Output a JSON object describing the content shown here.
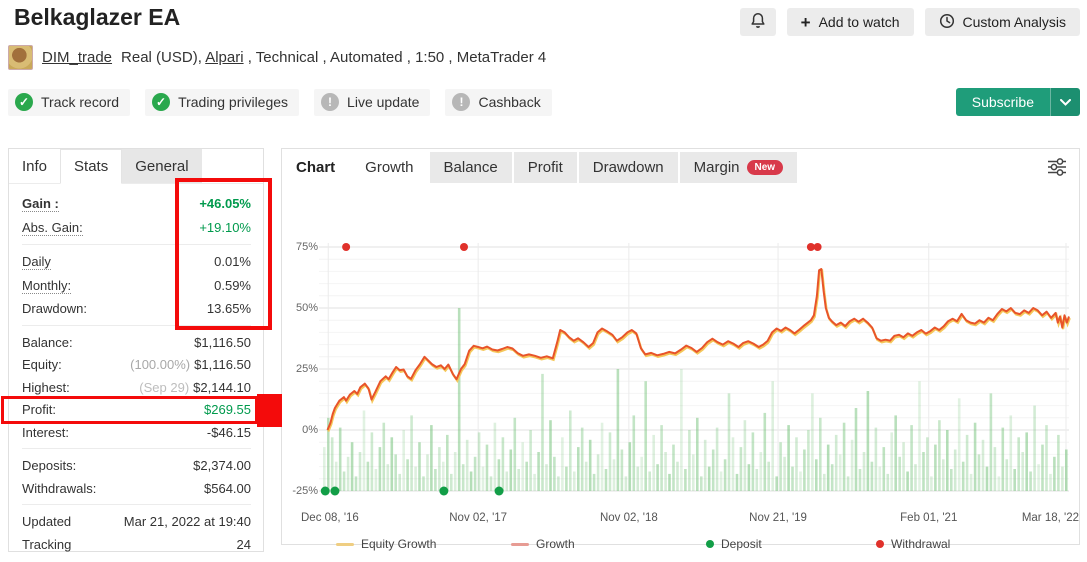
{
  "header": {
    "title": "Belkaglazer EA",
    "add_to_watch": "Add to watch",
    "custom_analysis": "Custom Analysis",
    "subscribe": "Subscribe"
  },
  "account": {
    "username": "DIM_trade",
    "info_pre": "Real (USD), ",
    "broker": "Alpari",
    "info_post": " , Technical , Automated , 1:50 , MetaTrader 4"
  },
  "badges": [
    {
      "label": "Track record",
      "status": "ok"
    },
    {
      "label": "Trading privileges",
      "status": "ok"
    },
    {
      "label": "Live update",
      "status": "info"
    },
    {
      "label": "Cashback",
      "status": "info"
    }
  ],
  "left_panel": {
    "tabs": [
      "Info",
      "Stats",
      "General"
    ],
    "active_tab": "Stats",
    "rows": [
      {
        "label": "Gain :",
        "value": "+46.05%"
      },
      {
        "label": "Abs. Gain:",
        "value": "+19.10%"
      },
      {
        "label": "Daily",
        "value": "0.01%"
      },
      {
        "label": "Monthly:",
        "value": "0.59%"
      },
      {
        "label": "Drawdown:",
        "value": "13.65%"
      },
      {
        "label": "Balance:",
        "value": "$1,116.50"
      },
      {
        "label": "Equity:",
        "prefix": "(100.00%)",
        "value": "$1,116.50"
      },
      {
        "label": "Highest:",
        "prefix": "(Sep 29)",
        "value": "$2,144.10"
      },
      {
        "label": "Profit:",
        "value": "$269.55"
      },
      {
        "label": "Interest:",
        "value": "-$46.15"
      },
      {
        "label": "Deposits:",
        "value": "$2,374.00"
      },
      {
        "label": "Withdrawals:",
        "value": "$564.00"
      },
      {
        "label": "Updated",
        "value": "Mar 21, 2022 at 19:40"
      },
      {
        "label": "Tracking",
        "value": "24"
      }
    ]
  },
  "chart_panel": {
    "label": "Chart",
    "tabs": [
      "Growth",
      "Balance",
      "Profit",
      "Drawdown",
      "Margin"
    ],
    "active_tab": "Growth",
    "margin_badge": "New"
  },
  "colors": {
    "growth_line": "#e8542a",
    "equity_line": "#f5c75a",
    "bar_green": "#6abe70",
    "deposit_dot": "#129e47",
    "withdrawal_dot": "#e0312b",
    "gain_green": "#009a4d",
    "subscribe_teal": "#1f9d7a",
    "annotation_red": "#f40b0b"
  },
  "chart_data": {
    "type": "line",
    "title": "Growth",
    "ylim": [
      -25,
      78
    ],
    "y_ticks": [
      "75%",
      "50%",
      "25%",
      "0%",
      "-25%"
    ],
    "y_tick_values": [
      75,
      50,
      25,
      0,
      -25
    ],
    "x_ticks": [
      "Dec 08, '16",
      "Nov 02, '17",
      "Nov 02, '18",
      "Nov 21, '19",
      "Feb 01, '21",
      "Mar 18, '22"
    ],
    "x_tick_fractions": [
      0.007,
      0.208,
      0.41,
      0.61,
      0.812,
      0.996
    ],
    "legend": [
      {
        "label": "Equity Growth",
        "type": "line",
        "color": "#efce82"
      },
      {
        "label": "Growth",
        "type": "line",
        "color": "#e79c94"
      },
      {
        "label": "Deposit",
        "type": "dot",
        "color": "#129e47"
      },
      {
        "label": "Withdrawal",
        "type": "dot",
        "color": "#e0312b"
      }
    ],
    "series": [
      {
        "name": "Growth",
        "color": "#e8542a",
        "points": [
          [
            0.006,
            0
          ],
          [
            0.01,
            3
          ],
          [
            0.013,
            6.5
          ],
          [
            0.016,
            9
          ],
          [
            0.022,
            12
          ],
          [
            0.028,
            13.5
          ],
          [
            0.031,
            12
          ],
          [
            0.036,
            14.5
          ],
          [
            0.042,
            16
          ],
          [
            0.046,
            14.8
          ],
          [
            0.05,
            17.5
          ],
          [
            0.056,
            19
          ],
          [
            0.061,
            17
          ],
          [
            0.065,
            12.5
          ],
          [
            0.07,
            15.5
          ],
          [
            0.077,
            20
          ],
          [
            0.084,
            22
          ],
          [
            0.088,
            20.8
          ],
          [
            0.093,
            23.5
          ],
          [
            0.098,
            25.8
          ],
          [
            0.103,
            24.5
          ],
          [
            0.108,
            24.8
          ],
          [
            0.113,
            22
          ],
          [
            0.118,
            21
          ],
          [
            0.124,
            24.5
          ],
          [
            0.13,
            27
          ],
          [
            0.136,
            30
          ],
          [
            0.141,
            28.5
          ],
          [
            0.146,
            27
          ],
          [
            0.152,
            25.8
          ],
          [
            0.158,
            26.5
          ],
          [
            0.163,
            25
          ],
          [
            0.168,
            26.8
          ],
          [
            0.174,
            23
          ],
          [
            0.179,
            20.8
          ],
          [
            0.185,
            25
          ],
          [
            0.19,
            27
          ],
          [
            0.196,
            32.5
          ],
          [
            0.202,
            34.5
          ],
          [
            0.208,
            34
          ],
          [
            0.214,
            33.5
          ],
          [
            0.22,
            34.2
          ],
          [
            0.227,
            33
          ],
          [
            0.234,
            32.6
          ],
          [
            0.24,
            33.2
          ],
          [
            0.247,
            34
          ],
          [
            0.254,
            33.4
          ],
          [
            0.261,
            31.5
          ],
          [
            0.268,
            30.4
          ],
          [
            0.276,
            31
          ],
          [
            0.284,
            30.4
          ],
          [
            0.292,
            29.6
          ],
          [
            0.3,
            30.2
          ],
          [
            0.308,
            29.4
          ],
          [
            0.314,
            36
          ],
          [
            0.318,
            41
          ],
          [
            0.324,
            40
          ],
          [
            0.33,
            38
          ],
          [
            0.336,
            36.6
          ],
          [
            0.342,
            37.6
          ],
          [
            0.349,
            36
          ],
          [
            0.356,
            34
          ],
          [
            0.362,
            35.6
          ],
          [
            0.368,
            40
          ],
          [
            0.374,
            41.6
          ],
          [
            0.381,
            40.4
          ],
          [
            0.388,
            39
          ],
          [
            0.394,
            36.6
          ],
          [
            0.401,
            38
          ],
          [
            0.408,
            40
          ],
          [
            0.414,
            41
          ],
          [
            0.42,
            39.6
          ],
          [
            0.426,
            33.6
          ],
          [
            0.432,
            31
          ],
          [
            0.44,
            31.6
          ],
          [
            0.448,
            30.6
          ],
          [
            0.456,
            31.2
          ],
          [
            0.464,
            32
          ],
          [
            0.472,
            31.4
          ],
          [
            0.48,
            33
          ],
          [
            0.487,
            34.6
          ],
          [
            0.494,
            33.6
          ],
          [
            0.501,
            32
          ],
          [
            0.508,
            33.6
          ],
          [
            0.515,
            36
          ],
          [
            0.522,
            37.4
          ],
          [
            0.529,
            36
          ],
          [
            0.536,
            35
          ],
          [
            0.543,
            36.4
          ],
          [
            0.55,
            35.4
          ],
          [
            0.557,
            34
          ],
          [
            0.563,
            35.6
          ],
          [
            0.57,
            36.4
          ],
          [
            0.577,
            35.4
          ],
          [
            0.584,
            34
          ],
          [
            0.59,
            35
          ],
          [
            0.596,
            36.5
          ],
          [
            0.602,
            40
          ],
          [
            0.608,
            41.6
          ],
          [
            0.614,
            40.6
          ],
          [
            0.62,
            42
          ],
          [
            0.626,
            41
          ],
          [
            0.632,
            39.6
          ],
          [
            0.638,
            41
          ],
          [
            0.644,
            42.6
          ],
          [
            0.65,
            44
          ],
          [
            0.654,
            45
          ],
          [
            0.658,
            47
          ],
          [
            0.662,
            55
          ],
          [
            0.665,
            65.5
          ],
          [
            0.668,
            66
          ],
          [
            0.671,
            57
          ],
          [
            0.674,
            50
          ],
          [
            0.678,
            46
          ],
          [
            0.682,
            44.6
          ],
          [
            0.688,
            43
          ],
          [
            0.694,
            44
          ],
          [
            0.7,
            42.6
          ],
          [
            0.706,
            44.6
          ],
          [
            0.712,
            45.6
          ],
          [
            0.718,
            44.4
          ],
          [
            0.724,
            45.6
          ],
          [
            0.73,
            44
          ],
          [
            0.736,
            42
          ],
          [
            0.742,
            37.6
          ],
          [
            0.748,
            36.6
          ],
          [
            0.754,
            37
          ],
          [
            0.76,
            36.6
          ],
          [
            0.766,
            38.6
          ],
          [
            0.772,
            39
          ],
          [
            0.778,
            38
          ],
          [
            0.784,
            39.6
          ],
          [
            0.79,
            38.6
          ],
          [
            0.796,
            40
          ],
          [
            0.802,
            41
          ],
          [
            0.808,
            39.5
          ],
          [
            0.814,
            40.5
          ],
          [
            0.82,
            42
          ],
          [
            0.826,
            41
          ],
          [
            0.832,
            42.5
          ],
          [
            0.838,
            44.6
          ],
          [
            0.844,
            45.6
          ],
          [
            0.85,
            44.6
          ],
          [
            0.856,
            47.6
          ],
          [
            0.862,
            45
          ],
          [
            0.868,
            44
          ],
          [
            0.874,
            43.6
          ],
          [
            0.88,
            45
          ],
          [
            0.886,
            44
          ],
          [
            0.892,
            46
          ],
          [
            0.898,
            45
          ],
          [
            0.904,
            47.6
          ],
          [
            0.91,
            49.6
          ],
          [
            0.916,
            48.6
          ],
          [
            0.922,
            50
          ],
          [
            0.928,
            48
          ],
          [
            0.934,
            47.5
          ],
          [
            0.94,
            49
          ],
          [
            0.946,
            48
          ],
          [
            0.952,
            50
          ],
          [
            0.958,
            49
          ],
          [
            0.964,
            47
          ],
          [
            0.97,
            48.5
          ],
          [
            0.976,
            46
          ],
          [
            0.982,
            48
          ],
          [
            0.985,
            44
          ],
          [
            0.988,
            46.5
          ],
          [
            0.991,
            42
          ],
          [
            0.994,
            47
          ],
          [
            0.997,
            44
          ],
          [
            1.0,
            46.5
          ]
        ]
      },
      {
        "name": "Equity Growth",
        "color": "#f5c75a",
        "points": "same-as-growth-offset"
      }
    ],
    "deposit_markers_x": [
      0.003,
      0.016,
      0.162,
      0.236
    ],
    "deposit_marker_y": -25,
    "withdrawal_markers_x": [
      0.031,
      0.189,
      0.654,
      0.663
    ],
    "withdrawal_marker_y": 75,
    "volume_bars": {
      "color": "#6abe70",
      "heights": [
        18,
        30,
        22,
        12,
        26,
        8,
        14,
        20,
        6,
        16,
        33,
        12,
        24,
        9,
        18,
        28,
        11,
        22,
        15,
        7,
        25,
        13,
        31,
        10,
        20,
        6,
        15,
        27,
        9,
        18,
        12,
        23,
        7,
        16,
        75,
        11,
        21,
        8,
        14,
        24,
        10,
        19,
        6,
        28,
        13,
        22,
        8,
        17,
        30,
        9,
        20,
        12,
        25,
        7,
        16,
        48,
        11,
        29,
        14,
        6,
        22,
        10,
        33,
        8,
        18,
        26,
        12,
        21,
        7,
        15,
        28,
        9,
        24,
        13,
        50,
        17,
        6,
        20,
        31,
        10,
        14,
        45,
        8,
        23,
        11,
        27,
        16,
        7,
        19,
        12,
        50,
        9,
        25,
        15,
        30,
        6,
        21,
        10,
        17,
        26,
        8,
        13,
        40,
        22,
        7,
        18,
        29,
        11,
        24,
        9,
        16,
        32,
        12,
        45,
        6,
        20,
        14,
        27,
        10,
        22,
        8,
        17,
        25,
        40,
        13,
        30,
        7,
        19,
        11,
        23,
        15,
        28,
        6,
        21,
        34,
        9,
        16,
        41,
        12,
        26,
        10,
        18,
        7,
        24,
        31,
        14,
        20,
        8,
        27,
        11,
        45,
        16,
        22,
        6,
        19,
        29,
        13,
        25,
        9,
        17,
        38,
        12,
        23,
        7,
        28,
        15,
        21,
        10,
        40,
        18,
        6,
        26,
        13,
        31,
        9,
        22,
        16,
        24,
        8,
        35,
        11,
        19,
        27,
        7,
        14,
        23,
        10,
        17
      ]
    },
    "grid": {
      "major_y_step": 25,
      "minor_y_step": 5,
      "vertical_at_x_ticks": true
    }
  }
}
